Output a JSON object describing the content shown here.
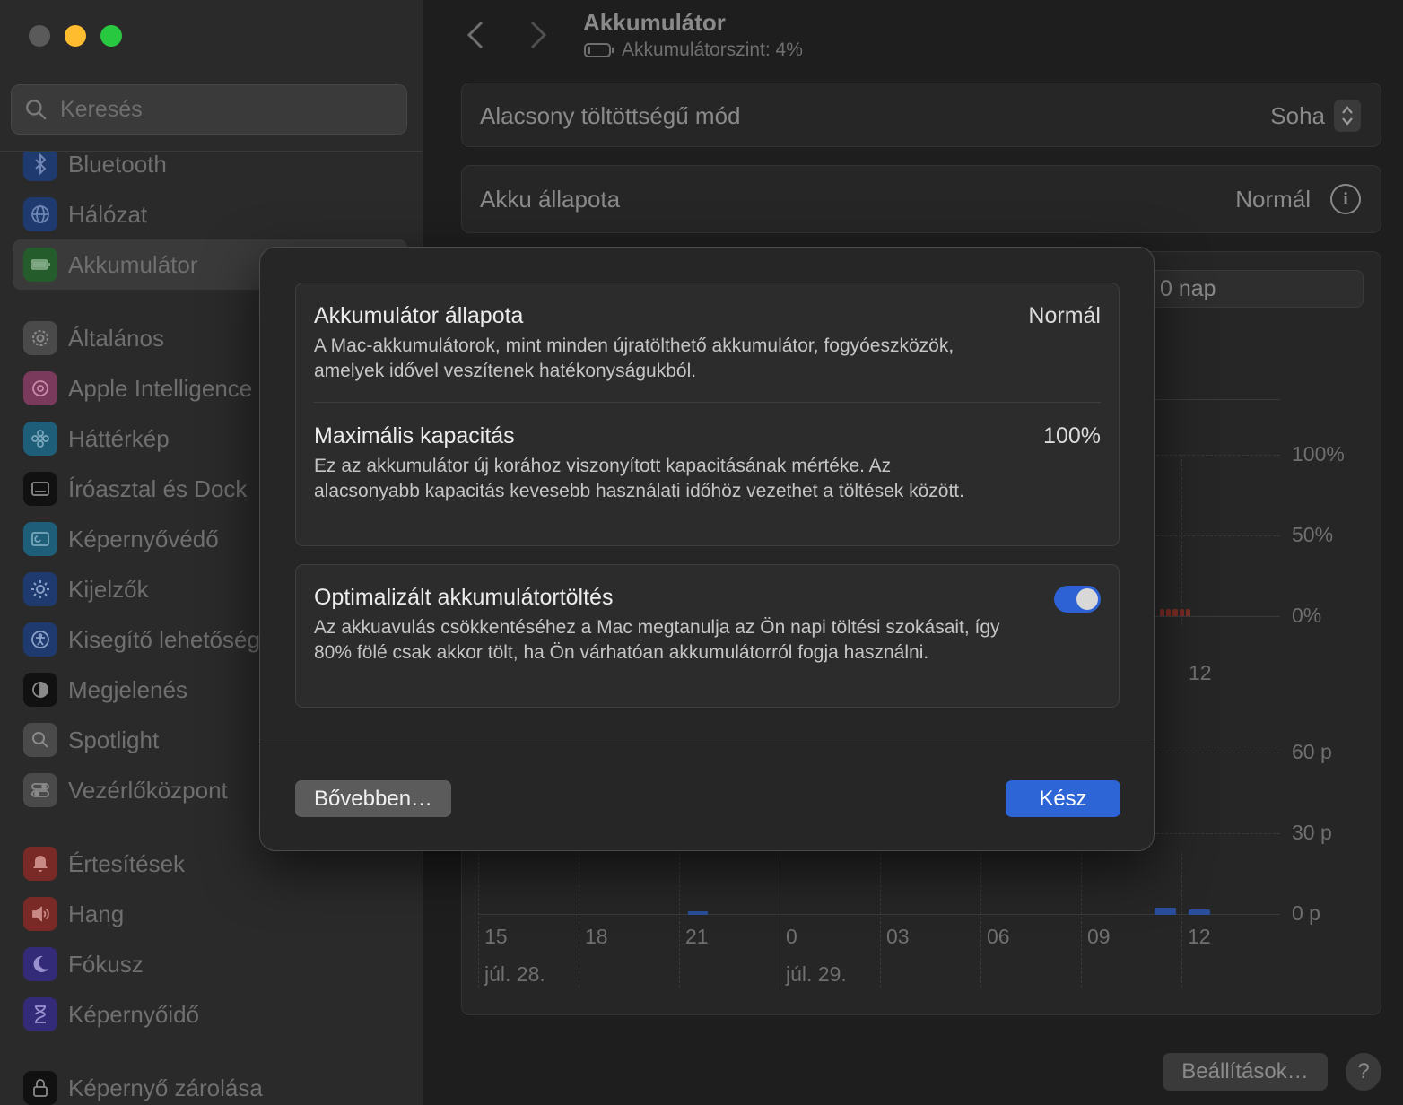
{
  "sidebar": {
    "search_placeholder": "Keresés",
    "items": [
      {
        "label": "Bluetooth",
        "icon": "bluetooth-icon",
        "color": "#2d5fbf"
      },
      {
        "label": "Hálózat",
        "icon": "globe-icon",
        "color": "#2d5fbf"
      },
      {
        "label": "Akkumulátor",
        "icon": "battery-icon",
        "color": "#2f8f3a"
      },
      {
        "label": "Általános",
        "icon": "gear-icon",
        "color": "#6a6a6a"
      },
      {
        "label": "Apple Intelligence",
        "icon": "apple-intelligence-icon",
        "color": "#b2457a"
      },
      {
        "label": "Háttérkép",
        "icon": "flower-icon",
        "color": "#2d8fb5"
      },
      {
        "label": "Íróasztal és Dock",
        "icon": "dock-icon",
        "color": "#2e2e2e"
      },
      {
        "label": "Képernyővédő",
        "icon": "screensaver-icon",
        "color": "#2d8fb5"
      },
      {
        "label": "Kijelzők",
        "icon": "sun-icon",
        "color": "#2d5fbf"
      },
      {
        "label": "Kisegítő lehetőségek",
        "icon": "accessibility-icon",
        "color": "#2d5fbf"
      },
      {
        "label": "Megjelenés",
        "icon": "appearance-icon",
        "color": "#2e2e2e"
      },
      {
        "label": "Spotlight",
        "icon": "magnifier-icon",
        "color": "#6a6a6a"
      },
      {
        "label": "Vezérlőközpont",
        "icon": "control-center-icon",
        "color": "#6a6a6a"
      },
      {
        "label": "Értesítések",
        "icon": "bell-icon",
        "color": "#c4403a"
      },
      {
        "label": "Hang",
        "icon": "speaker-icon",
        "color": "#c4403a"
      },
      {
        "label": "Fókusz",
        "icon": "moon-icon",
        "color": "#4b3fb5"
      },
      {
        "label": "Képernyőidő",
        "icon": "hourglass-icon",
        "color": "#4b3fb5"
      },
      {
        "label": "Képernyő zárolása",
        "icon": "lock-icon",
        "color": "#2e2e2e"
      }
    ]
  },
  "header": {
    "title": "Akkumulátor",
    "subtitle": "Akkumulátorszint: 4%"
  },
  "settings": {
    "low_power_label": "Alacsony töltöttségű mód",
    "low_power_value": "Soha",
    "health_label": "Akku állapota",
    "health_value": "Normál",
    "period_label": "0 nap"
  },
  "chart": {
    "level_ticks": [
      "100%",
      "50%",
      "0%"
    ],
    "level_x_label": "12",
    "usage_ticks": [
      "60 p",
      "30 p",
      "0 p"
    ],
    "x_labels": [
      "15",
      "18",
      "21",
      "0",
      "03",
      "06",
      "09",
      "12"
    ],
    "date_labels": [
      "júl. 28.",
      "júl. 29."
    ]
  },
  "footer": {
    "settings_button": "Beállítások…",
    "help_button": "?"
  },
  "modal": {
    "health_title": "Akkumulátor állapota",
    "health_value": "Normál",
    "health_desc": "A Mac-akkumulátorok, mint minden újratölthető akkumulátor, fogyóeszközök, amelyek idővel veszítenek hatékonyságukból.",
    "capacity_title": "Maximális kapacitás",
    "capacity_value": "100%",
    "capacity_desc": "Ez az akkumulátor új korához viszonyított kapacitásának mértéke. Az alacsonyabb kapacitás kevesebb használati időhöz vezethet a töltések között.",
    "optimized_title": "Optimalizált akkumulátortöltés",
    "optimized_desc": "Az akkuavulás csökkentéséhez a Mac megtanulja az Ön napi töltési szokásait, így 80% fölé csak akkor tölt, ha Ön várhatóan akkumulátorról fogja használni.",
    "optimized_enabled": true,
    "more_button": "Bővebben…",
    "done_button": "Kész"
  },
  "colors": {
    "accent": "#2d64d6",
    "toggle_on": "#2c62d3"
  }
}
